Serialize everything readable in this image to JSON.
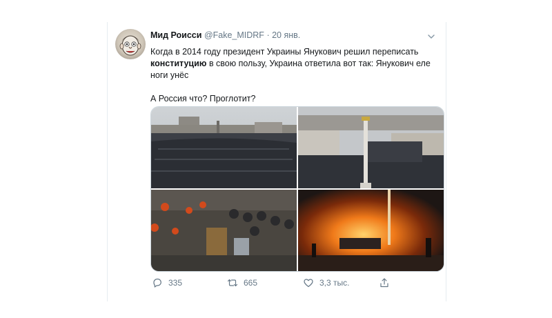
{
  "tweet": {
    "author_name": "Мид Роисси",
    "handle": "@Fake_MIDRF",
    "separator": "·",
    "date": "20 янв.",
    "text_line1_part1": "Когда в 2014 году президент Украины Янукович решил переписать",
    "text_bold": "конституцию",
    "text_line2_rest": " в свою пользу, Украина ответила вот так: Янукович еле",
    "text_line3": "ноги унёс",
    "text_question": "А Россия что? Проглотит?",
    "replies": "335",
    "retweets": "665",
    "likes": "3,3 тыс."
  },
  "media": [
    {
      "name": "photo-crowd-square",
      "icon": "image-icon"
    },
    {
      "name": "photo-independence-monument",
      "icon": "image-icon"
    },
    {
      "name": "photo-clashes-shields",
      "icon": "image-icon"
    },
    {
      "name": "photo-fire-night",
      "icon": "image-icon"
    }
  ],
  "colors": {
    "text": "#14171a",
    "secondary": "#657786",
    "border": "#e6ecf0"
  }
}
